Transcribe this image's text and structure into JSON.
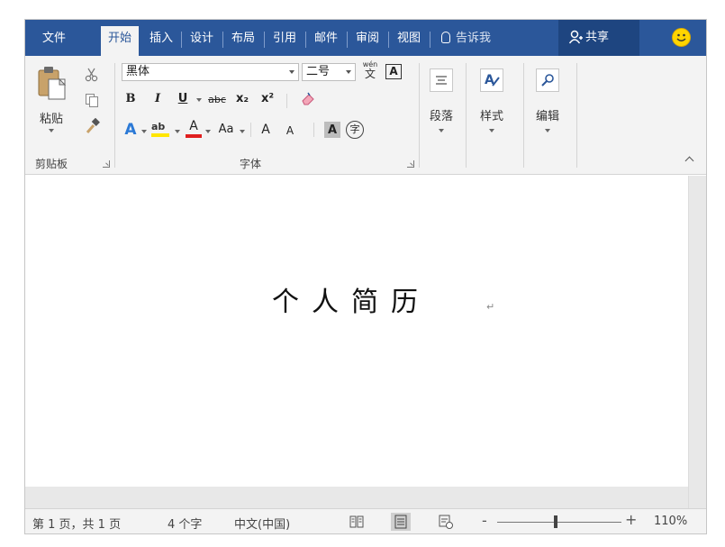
{
  "tabs": [
    {
      "label": "文件",
      "active": false
    },
    {
      "label": "开始",
      "active": true
    },
    {
      "label": "插入",
      "active": false
    },
    {
      "label": "设计",
      "active": false
    },
    {
      "label": "布局",
      "active": false
    },
    {
      "label": "引用",
      "active": false
    },
    {
      "label": "邮件",
      "active": false
    },
    {
      "label": "审阅",
      "active": false
    },
    {
      "label": "视图",
      "active": false
    }
  ],
  "tell_me": "告诉我",
  "share_label": "共享",
  "colors": {
    "ribbon_blue": "#2b579a",
    "share_bg": "#1e4580",
    "ribbon_bg": "#f3f3f3",
    "highlight_yellow": "#ffe600",
    "font_color_red": "#e01f1f",
    "smiley": "#ffd500"
  },
  "clipboard": {
    "paste_label": "粘贴",
    "group_label": "剪贴板",
    "icons": [
      "cut-icon",
      "copy-icon",
      "format-painter-icon"
    ]
  },
  "font": {
    "font_name": "黑体",
    "font_size": "二号",
    "pinyin_glyph": "wén",
    "pinyin_char": "文",
    "border_char": "A",
    "bold": "B",
    "italic": "I",
    "underline": "U",
    "strike": "abc",
    "subscript": "x₂",
    "superscript": "x²",
    "text_effect": "A",
    "highlight": "ab",
    "font_color": "A",
    "change_case": "Aa",
    "grow_font": "A",
    "shrink_font": "A",
    "shading_char": "A",
    "enclose_char": "字",
    "group_label": "字体"
  },
  "paragraph_label": "段落",
  "styles_label": "样式",
  "editing_label": "编辑",
  "document": {
    "title_text": "个人简历",
    "paragraph_mark": "↵"
  },
  "status": {
    "page": "第 1 页，共 1 页",
    "words": "4 个字",
    "language": "中文(中国)",
    "zoom": "110%",
    "zoom_minus": "-",
    "zoom_plus": "+"
  }
}
